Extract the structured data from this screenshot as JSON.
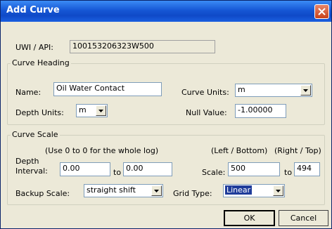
{
  "window": {
    "title": "Add Curve"
  },
  "uwi": {
    "label": "UWI / API:",
    "value": "100153206323W500"
  },
  "heading": {
    "group_label": "Curve Heading",
    "name_label": "Name:",
    "name_value": "Oil Water Contact",
    "curve_units_label": "Curve Units:",
    "curve_units_value": "m",
    "depth_units_label": "Depth Units:",
    "depth_units_value": "m",
    "null_label": "Null Value:",
    "null_value": "-1.00000"
  },
  "scale": {
    "group_label": "Curve Scale",
    "depth_hint": "(Use 0 to 0 for the whole log)",
    "depth_label_1": "Depth",
    "depth_label_2": "Interval:",
    "depth_from": "0.00",
    "to_1": "to",
    "depth_to": "0.00",
    "left_hint": "(Left / Bottom)",
    "right_hint": "(Right / Top)",
    "scale_label": "Scale:",
    "scale_left": "500",
    "to_2": "to",
    "scale_right": "494",
    "backup_label": "Backup Scale:",
    "backup_value": "straight shift",
    "grid_label": "Grid Type:",
    "grid_value": "Linear"
  },
  "buttons": {
    "ok": "OK",
    "cancel": "Cancel"
  },
  "icons": {
    "close": "close-icon",
    "dropdown": "chevron-down-icon"
  }
}
